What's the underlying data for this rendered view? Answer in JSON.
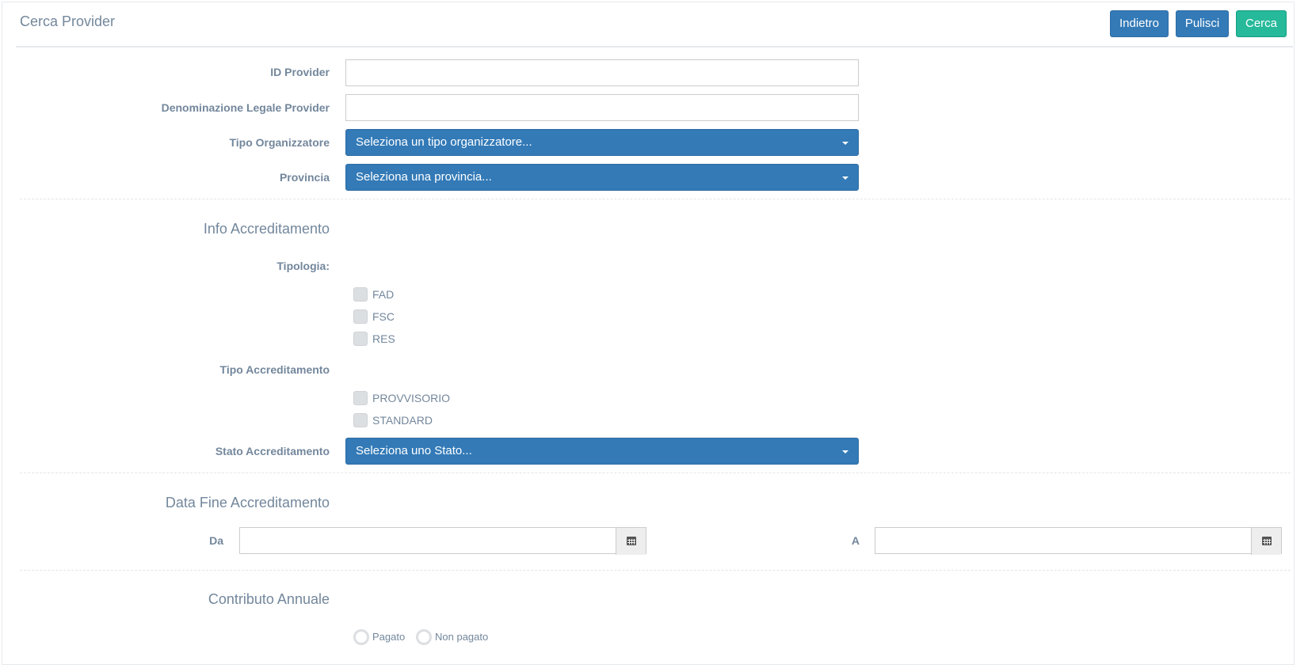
{
  "header": {
    "title": "Cerca Provider",
    "buttons": {
      "back": "Indietro",
      "clear": "Pulisci",
      "search": "Cerca"
    }
  },
  "form": {
    "id_provider": {
      "label": "ID Provider",
      "value": ""
    },
    "denominazione": {
      "label": "Denominazione Legale Provider",
      "value": ""
    },
    "tipo_organizzatore": {
      "label": "Tipo Organizzatore",
      "value": "Seleziona un tipo organizzatore..."
    },
    "provincia": {
      "label": "Provincia",
      "value": "Seleziona una provincia..."
    }
  },
  "info_accreditamento": {
    "title": "Info Accreditamento",
    "tipologia": {
      "label": "Tipologia:",
      "options": [
        "FAD",
        "FSC",
        "RES"
      ]
    },
    "tipo_accreditamento": {
      "label": "Tipo Accreditamento",
      "options": [
        "PROVVISORIO",
        "STANDARD"
      ]
    },
    "stato": {
      "label": "Stato Accreditamento",
      "value": "Seleziona uno Stato..."
    }
  },
  "data_fine": {
    "title": "Data Fine Accreditamento",
    "from_label": "Da",
    "to_label": "A",
    "from_value": "",
    "to_value": ""
  },
  "contributo": {
    "title": "Contributo Annuale",
    "options": [
      "Pagato",
      "Non pagato"
    ]
  },
  "colors": {
    "primary": "#337AB7",
    "success": "#26B99A",
    "text": "#73879C"
  }
}
